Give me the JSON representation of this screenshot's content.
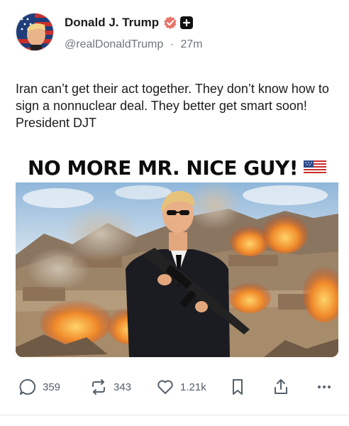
{
  "post": {
    "author_name": "Donald J. Trump",
    "handle": "@realDonaldTrump",
    "separator": "·",
    "time": "27m",
    "text": "Iran can’t get their act together. They don’t know how to sign a nonnuclear deal. They better get smart soon! President DJT"
  },
  "media": {
    "headline": "NO MORE MR. NICE GUY!"
  },
  "actions": {
    "replies": "359",
    "retruths": "343",
    "likes": "1.21k"
  },
  "colors": {
    "verified_badge": "#e8756a",
    "action_icon": "#55606b",
    "sky": "#a9c7e2",
    "fire": "#f08a2a"
  },
  "icons": [
    "verified-badge-icon",
    "follow-plus-icon",
    "reply-icon",
    "retruth-icon",
    "like-icon",
    "bookmark-icon",
    "share-icon",
    "more-icon",
    "us-flag-icon"
  ]
}
